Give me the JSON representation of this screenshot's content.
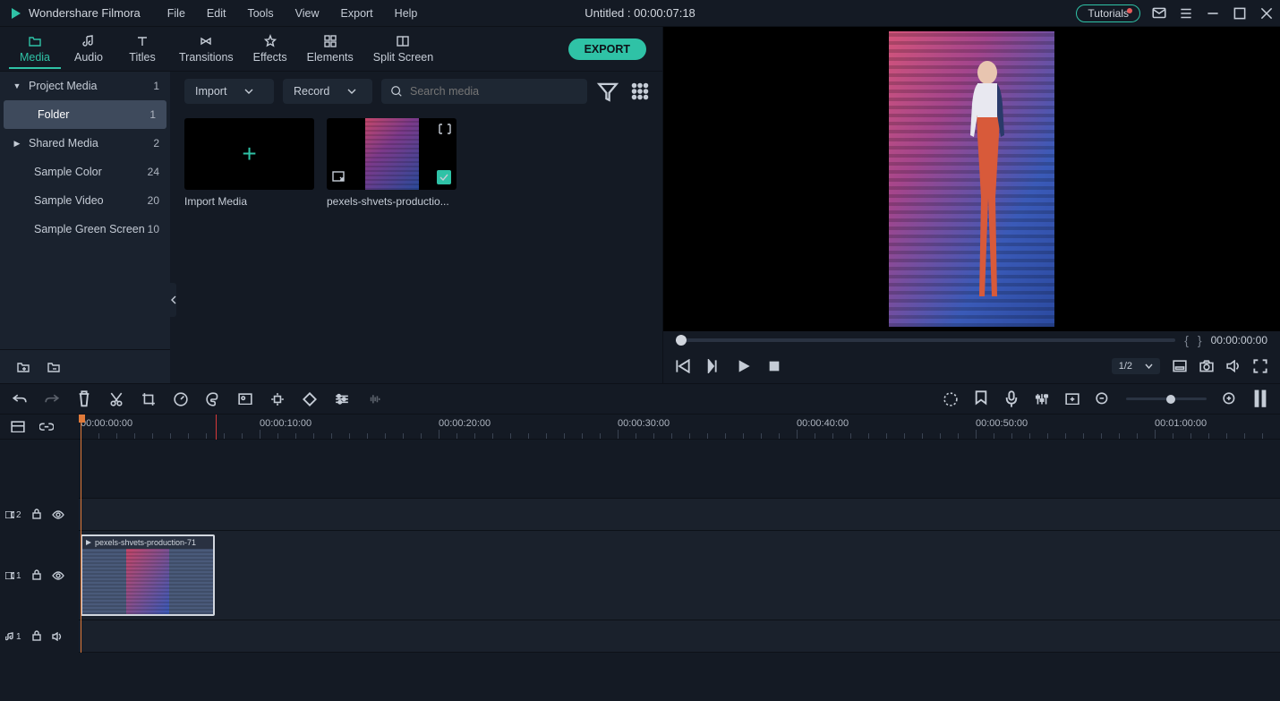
{
  "app_title": "Wondershare Filmora",
  "menu": [
    "File",
    "Edit",
    "Tools",
    "View",
    "Export",
    "Help"
  ],
  "project_title": "Untitled : 00:00:07:18",
  "tutorials_label": "Tutorials",
  "tabs": [
    {
      "label": "Media",
      "icon": "folder",
      "active": true
    },
    {
      "label": "Audio",
      "icon": "music"
    },
    {
      "label": "Titles",
      "icon": "title"
    },
    {
      "label": "Transitions",
      "icon": "trans"
    },
    {
      "label": "Effects",
      "icon": "star"
    },
    {
      "label": "Elements",
      "icon": "elements"
    },
    {
      "label": "Split Screen",
      "icon": "split"
    }
  ],
  "export_label": "EXPORT",
  "sidebar": [
    {
      "label": "Project Media",
      "count": 1,
      "arrow": "▼"
    },
    {
      "label": "Folder",
      "count": 1,
      "indent": true,
      "selected": true
    },
    {
      "label": "Shared Media",
      "count": 2,
      "arrow": "▶"
    },
    {
      "label": "Sample Color",
      "count": 24,
      "indent": true
    },
    {
      "label": "Sample Video",
      "count": 20,
      "indent": true
    },
    {
      "label": "Sample Green Screen",
      "count": 10,
      "indent": true
    }
  ],
  "import_label": "Import",
  "record_label": "Record",
  "search_placeholder": "Search media",
  "import_card_label": "Import Media",
  "media_clip_label": "pexels-shvets-productio...",
  "preview_time": "00:00:00:00",
  "ratio": "1/2",
  "ruler_labels": [
    "00:00:00:00",
    "00:00:10:00",
    "00:00:20:00",
    "00:00:30:00",
    "00:00:40:00",
    "00:00:50:00",
    "00:01:00:00"
  ],
  "timeline_clip_label": "pexels-shvets-production-71",
  "tracks": {
    "video2": "2",
    "video1": "1",
    "audio1": "1"
  }
}
